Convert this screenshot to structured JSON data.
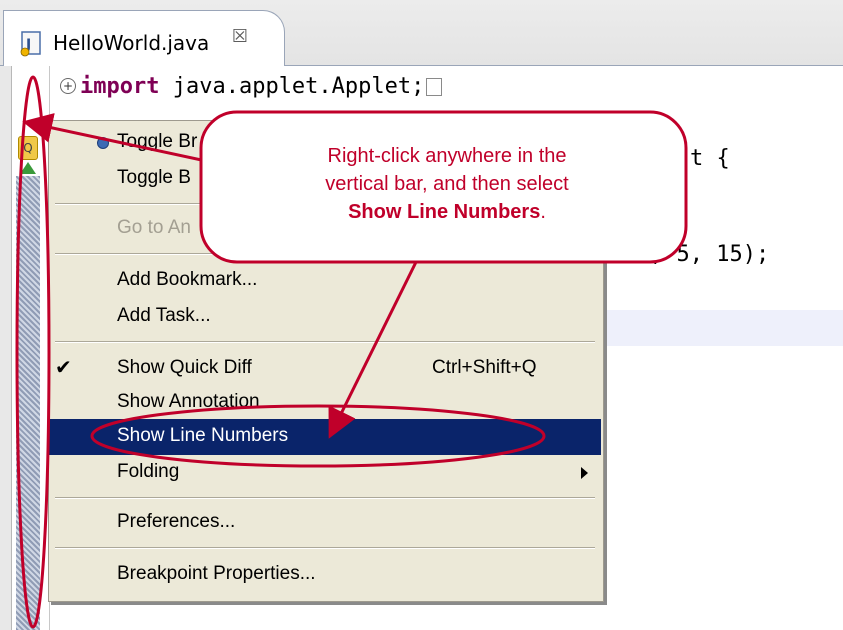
{
  "tab": {
    "title": "HelloWorld.java",
    "close_glyph": "☒",
    "icon": "java-file-icon"
  },
  "code": {
    "import_keyword": "import",
    "import_rest": " java.applet.Applet;",
    "collapsed_glyph": "..",
    "line_class_tail": "t {",
    "line_args": ", 5, 15);"
  },
  "ruler": {
    "quickdiff_glyph": "Q"
  },
  "menu": {
    "items": [
      {
        "label": "Toggle Br",
        "accel": "",
        "state": "normal"
      },
      {
        "label": "Toggle B",
        "accel": "",
        "state": "normal"
      },
      {
        "label": "Go to An",
        "accel": "",
        "state": "disabled"
      },
      {
        "label": "Add Bookmark...",
        "accel": "",
        "state": "normal"
      },
      {
        "label": "Add Task...",
        "accel": "",
        "state": "normal"
      },
      {
        "label": "Show Quick Diff",
        "accel": "Ctrl+Shift+Q",
        "state": "checked",
        "check": "✔"
      },
      {
        "label": "Show Annotation",
        "accel": "",
        "state": "normal"
      },
      {
        "label": "Show Line Numbers",
        "accel": "",
        "state": "selected"
      },
      {
        "label": "Folding",
        "accel": "",
        "state": "submenu"
      },
      {
        "label": "Preferences...",
        "accel": "",
        "state": "normal"
      },
      {
        "label": "Breakpoint Properties...",
        "accel": "",
        "state": "normal"
      }
    ]
  },
  "callout": {
    "line1": "Right-click anywhere in the",
    "line2": "vertical bar, and then select",
    "line3_bold": "Show Line Numbers",
    "line3_tail": "."
  },
  "colors": {
    "annotation_red": "#c0002a",
    "menu_selected": "#0a246a",
    "keyword": "#7f0055"
  }
}
